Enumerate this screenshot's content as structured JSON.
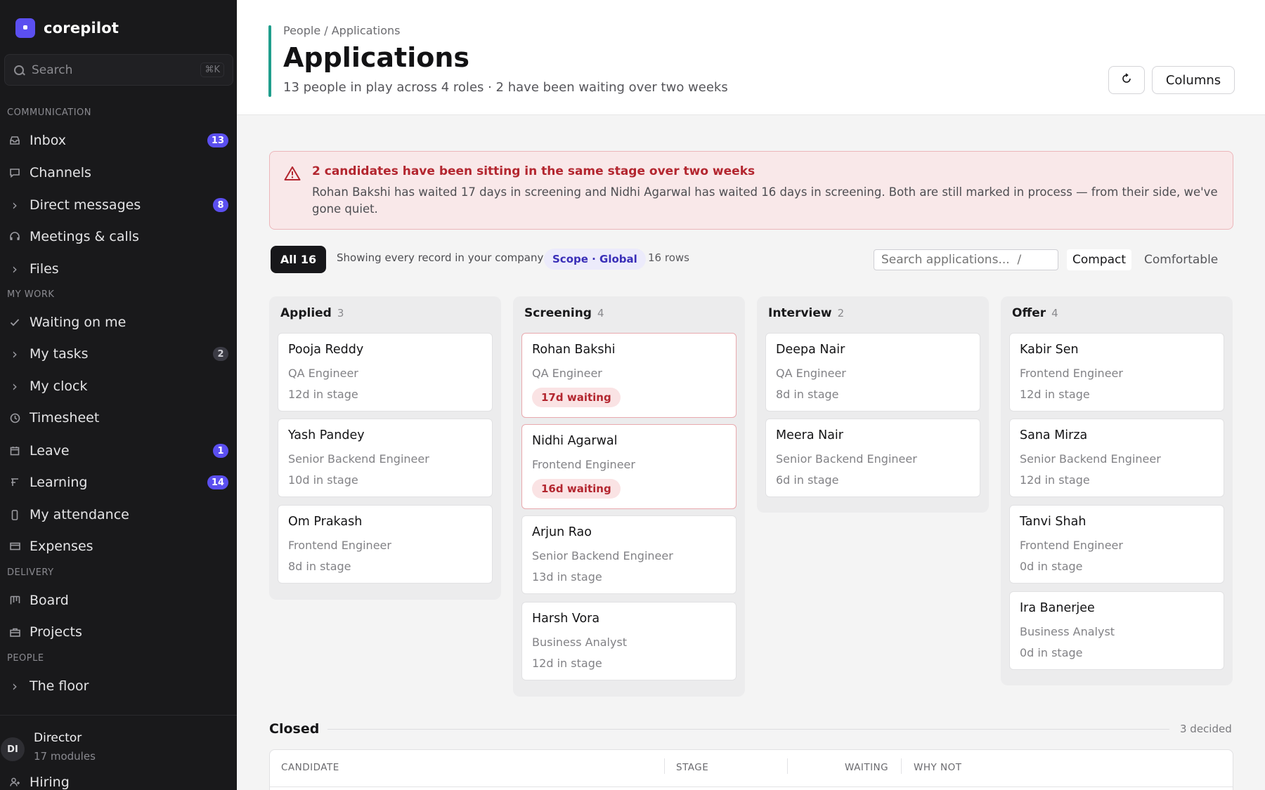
{
  "app": {
    "name": "corepilot"
  },
  "sidebar": {
    "search_placeholder": "Search",
    "search_shortcut": "⌘K",
    "sections": {
      "communication": "COMMUNICATION",
      "my_work": "MY WORK",
      "delivery": "DELIVERY",
      "people": "PEOPLE"
    },
    "items": [
      {
        "label": "Inbox",
        "icon": "inbox-icon",
        "badge": "13"
      },
      {
        "label": "Channels",
        "icon": "chat-icon"
      },
      {
        "label": "Direct messages",
        "icon": "chevron-right-icon",
        "badge": "8"
      },
      {
        "label": "Meetings & calls",
        "icon": "headset-icon"
      },
      {
        "label": "Files",
        "icon": "chevron-right-icon"
      },
      {
        "label": "Waiting on me",
        "icon": "check-icon"
      },
      {
        "label": "My tasks",
        "icon": "chevron-right-icon",
        "badge": "2"
      },
      {
        "label": "My clock",
        "icon": "chevron-right-icon"
      },
      {
        "label": "Timesheet",
        "icon": "clock-icon"
      },
      {
        "label": "Leave",
        "icon": "calendar-icon",
        "badge": "1"
      },
      {
        "label": "Learning",
        "icon": "book-icon",
        "badge": "14"
      },
      {
        "label": "My attendance",
        "icon": "phone-icon"
      },
      {
        "label": "Expenses",
        "icon": "card-icon"
      },
      {
        "label": "Board",
        "icon": "board-icon"
      },
      {
        "label": "Projects",
        "icon": "briefcase-icon"
      },
      {
        "label": "The floor",
        "icon": "chevron-right-icon"
      },
      {
        "label": "Hiring",
        "icon": "user-plus-icon"
      }
    ],
    "user": {
      "initials": "DI",
      "name": "Director",
      "sub": "17 modules"
    }
  },
  "header": {
    "breadcrumb": "People / Applications",
    "title": "Applications",
    "subtitle": "13 people in play across 4 roles · 2 have been waiting over two weeks",
    "columns_label": "Columns",
    "refresh_icon": "refresh-icon"
  },
  "alert": {
    "title": "2 candidates have been sitting in the same stage over two weeks",
    "body": "Rohan Bakshi has waited 17 days in screening and Nidhi Agarwal has waited 16 days in screening. Both are still marked in process — from their side, we've gone quiet.",
    "icon": "warning-icon",
    "color": "#b3262f"
  },
  "filters": {
    "all_label": "All 16",
    "showing": "Showing every record in your company",
    "scope": "Scope · Global",
    "rows": "16 rows",
    "search_placeholder": "Search applications...  /",
    "compact": "Compact",
    "comfortable": "Comfortable"
  },
  "board": {
    "columns": [
      {
        "name": "Applied",
        "count": "3",
        "cards": [
          {
            "name": "Pooja Reddy",
            "role": "QA Engineer",
            "meta": "12d in stage"
          },
          {
            "name": "Yash Pandey",
            "role": "Senior Backend Engineer",
            "meta": "10d in stage"
          },
          {
            "name": "Om Prakash",
            "role": "Frontend Engineer",
            "meta": "8d in stage"
          }
        ]
      },
      {
        "name": "Screening",
        "count": "4",
        "cards": [
          {
            "name": "Rohan Bakshi",
            "role": "QA Engineer",
            "badge": "17d waiting"
          },
          {
            "name": "Nidhi Agarwal",
            "role": "Frontend Engineer",
            "badge": "16d waiting"
          },
          {
            "name": "Arjun Rao",
            "role": "Senior Backend Engineer",
            "meta": "13d in stage"
          },
          {
            "name": "Harsh Vora",
            "role": "Business Analyst",
            "meta": "12d in stage"
          }
        ]
      },
      {
        "name": "Interview",
        "count": "2",
        "cards": [
          {
            "name": "Deepa Nair",
            "role": "QA Engineer",
            "meta": "8d in stage"
          },
          {
            "name": "Meera Nair",
            "role": "Senior Backend Engineer",
            "meta": "6d in stage"
          }
        ]
      },
      {
        "name": "Offer",
        "count": "4",
        "cards": [
          {
            "name": "Kabir Sen",
            "role": "Frontend Engineer",
            "meta": "12d in stage"
          },
          {
            "name": "Sana Mirza",
            "role": "Senior Backend Engineer",
            "meta": "12d in stage"
          },
          {
            "name": "Tanvi Shah",
            "role": "Frontend Engineer",
            "meta": "0d in stage"
          },
          {
            "name": "Ira Banerjee",
            "role": "Business Analyst",
            "meta": "0d in stage"
          }
        ]
      }
    ]
  },
  "closed": {
    "title": "Closed",
    "count": "3 decided",
    "headers": [
      "CANDIDATE",
      "STAGE",
      "WAITING",
      "WHY NOT"
    ]
  }
}
